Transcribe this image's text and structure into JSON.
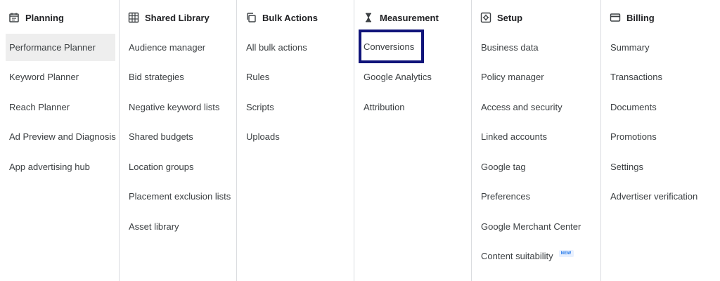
{
  "columns": [
    {
      "title": "Planning",
      "icon": "calendar-icon",
      "items": [
        "Performance Planner",
        "Keyword Planner",
        "Reach Planner",
        "Ad Preview and Diagnosis",
        "App advertising hub"
      ]
    },
    {
      "title": "Shared Library",
      "icon": "library-icon",
      "items": [
        "Audience manager",
        "Bid strategies",
        "Negative keyword lists",
        "Shared budgets",
        "Location groups",
        "Placement exclusion lists",
        "Asset library"
      ]
    },
    {
      "title": "Bulk Actions",
      "icon": "copy-icon",
      "items": [
        "All bulk actions",
        "Rules",
        "Scripts",
        "Uploads"
      ]
    },
    {
      "title": "Measurement",
      "icon": "hourglass-icon",
      "items": [
        "Conversions",
        "Google Analytics",
        "Attribution"
      ]
    },
    {
      "title": "Setup",
      "icon": "settings-box-icon",
      "items": [
        "Business data",
        "Policy manager",
        "Access and security",
        "Linked accounts",
        "Google tag",
        "Preferences",
        "Google Merchant Center",
        "Content suitability"
      ],
      "badge": "NEW"
    },
    {
      "title": "Billing",
      "icon": "credit-card-icon",
      "items": [
        "Summary",
        "Transactions",
        "Documents",
        "Promotions",
        "Settings",
        "Advertiser verification"
      ]
    }
  ],
  "colors": {
    "selected_bg": "#eeeeee",
    "highlight_border": "#10147a",
    "divider": "#dadce0",
    "badge_text": "#1a73e8"
  }
}
